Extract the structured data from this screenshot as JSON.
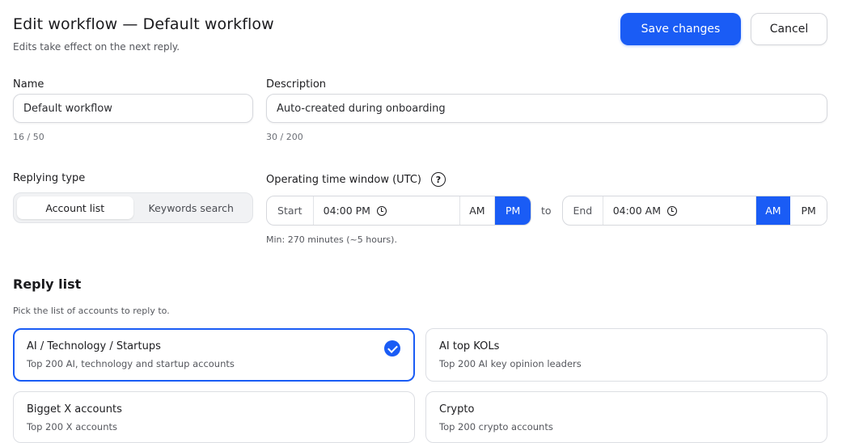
{
  "header": {
    "title": "Edit workflow — Default workflow",
    "subtitle": "Edits take effect on the next reply.",
    "save_label": "Save changes",
    "cancel_label": "Cancel"
  },
  "name_field": {
    "label": "Name",
    "value": "Default workflow",
    "counter": "16 / 50"
  },
  "description_field": {
    "label": "Description",
    "value": "Auto-created during onboarding",
    "counter": "30 / 200"
  },
  "replying_type": {
    "label": "Replying type",
    "options": [
      "Account list",
      "Keywords search"
    ],
    "selected": "Account list"
  },
  "time_window": {
    "label": "Operating time window (UTC)",
    "start_label": "Start",
    "start_time": "04:00 PM",
    "start_period": "PM",
    "to_label": "to",
    "end_label": "End",
    "end_time": "04:00 AM",
    "end_period": "AM",
    "am_label": "AM",
    "pm_label": "PM",
    "hint": "Min: 270 minutes (~5 hours)."
  },
  "reply_list": {
    "title": "Reply list",
    "subtitle": "Pick the list of accounts to reply to.",
    "cards": [
      {
        "title": "AI / Technology / Startups",
        "desc": "Top 200 AI, technology and startup accounts",
        "selected": true
      },
      {
        "title": "AI top KOLs",
        "desc": "Top 200 AI key opinion leaders",
        "selected": false
      },
      {
        "title": "Bigget X accounts",
        "desc": "Top 200 X accounts",
        "selected": false
      },
      {
        "title": "Crypto",
        "desc": "Top 200 crypto accounts",
        "selected": false
      }
    ]
  },
  "colors": {
    "accent": "#1a5cf5",
    "border": "#d6d8dd",
    "muted_text": "#55575d"
  }
}
